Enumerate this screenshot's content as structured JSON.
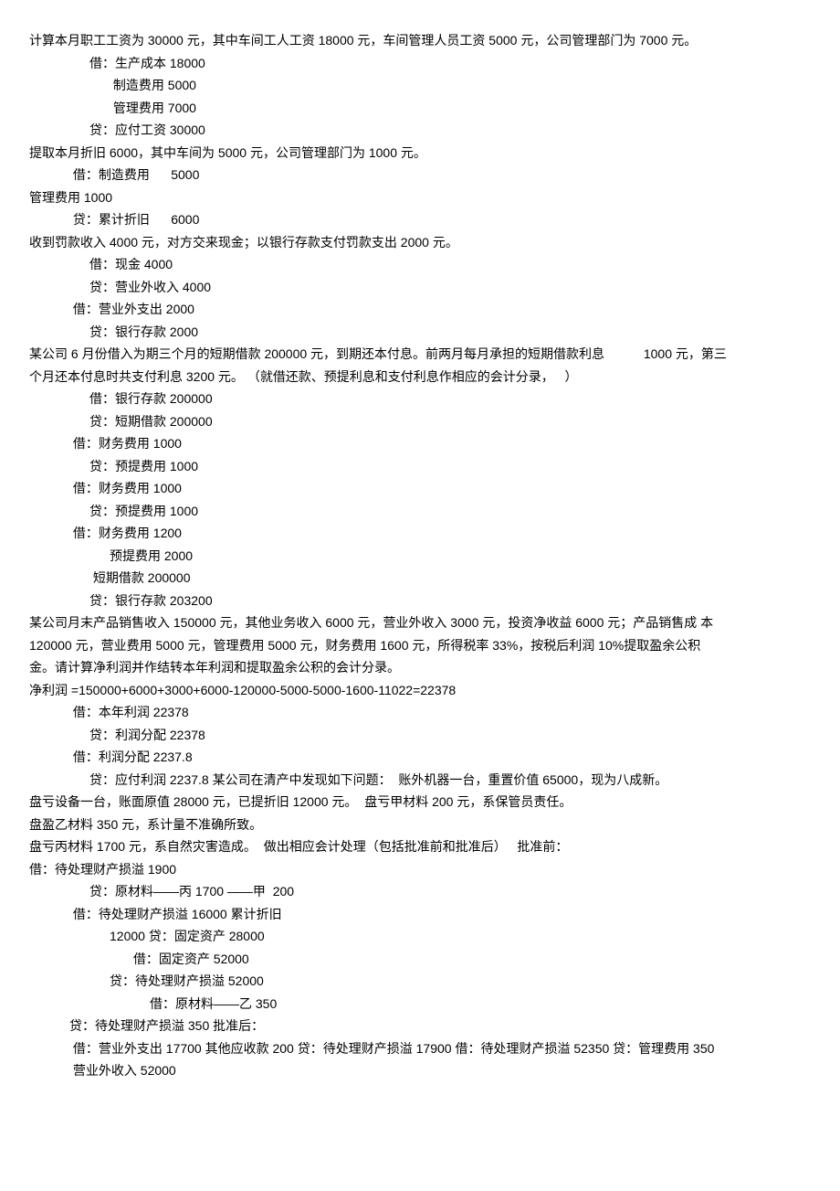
{
  "lines": [
    {
      "indent": 0,
      "text": "计算本月职工工资为 30000 元，其中车间工人工资 18000 元，车间管理人员工资 5000 元，公司管理部门为 7000 元。"
    },
    {
      "indent": 2,
      "text": "借：生产成本 18000"
    },
    {
      "indent": 3,
      "text": " 制造费用 5000"
    },
    {
      "indent": 3,
      "text": " 管理费用 7000"
    },
    {
      "indent": 2,
      "text": "贷：应付工资 30000"
    },
    {
      "indent": 0,
      "text": "提取本月折旧 6000，其中车间为 5000 元，公司管理部门为 1000 元。"
    },
    {
      "indent": 1,
      "text": " 借：制造费用      5000"
    },
    {
      "indent": 0,
      "text": "管理费用 1000"
    },
    {
      "indent": 1,
      "text": " 贷：累计折旧      6000"
    },
    {
      "indent": 0,
      "text": "收到罚款收入 4000 元，对方交来现金；以银行存款支付罚款支出 2000 元。"
    },
    {
      "indent": 2,
      "text": "借：现金 4000"
    },
    {
      "indent": 2,
      "text": "贷：营业外收入 4000"
    },
    {
      "indent": 1,
      "text": " 借：营业外支出 2000"
    },
    {
      "indent": 2,
      "text": "贷：银行存款 2000"
    },
    {
      "indent": 0,
      "text": "某公司 6 月份借入为期三个月的短期借款 200000 元，到期还本付息。前两月每月承担的短期借款利息           1000 元，第三"
    },
    {
      "indent": 0,
      "text": "个月还本付息时共支付利息 3200 元。 （就借还款、预提利息和支付利息作相应的会计分录，   ）"
    },
    {
      "indent": 2,
      "text": "借：银行存款 200000"
    },
    {
      "indent": 2,
      "text": "贷：短期借款 200000"
    },
    {
      "indent": 1,
      "text": " 借：财务费用 1000"
    },
    {
      "indent": 2,
      "text": "贷：预提费用 1000"
    },
    {
      "indent": 1,
      "text": " 借：财务费用 1000"
    },
    {
      "indent": 2,
      "text": "贷：预提费用 1000"
    },
    {
      "indent": 1,
      "text": " 借：财务费用 1200"
    },
    {
      "indent": 3,
      "text": "预提费用 2000"
    },
    {
      "indent": 2,
      "text": " 短期借款 200000"
    },
    {
      "indent": 2,
      "text": "贷：银行存款 203200"
    },
    {
      "indent": 0,
      "text": "某公司月末产品销售收入 150000 元，其他业务收入 6000 元，营业外收入 3000 元，投资净收益 6000 元；产品销售成 本 "
    },
    {
      "indent": 0,
      "text": "120000 元，营业费用 5000 元，管理费用 5000 元，财务费用 1600 元，所得税率 33%，按税后利润 10%提取盈余公积"
    },
    {
      "indent": 0,
      "text": "金。请计算净利润并作结转本年利润和提取盈余公积的会计分录。"
    },
    {
      "indent": 0,
      "text": "净利润 =150000+6000+3000+6000-120000-5000-5000-1600-11022=22378"
    },
    {
      "indent": 1,
      "text": " 借：本年利润 22378"
    },
    {
      "indent": 2,
      "text": "贷：利润分配 22378"
    },
    {
      "indent": 1,
      "text": " 借：利润分配 2237.8"
    },
    {
      "indent": 2,
      "text": "贷：应付利润 2237.8 某公司在清产中发现如下问题：  账外机器一台，重置价值 65000，现为八成新。"
    },
    {
      "indent": 0,
      "text": "盘亏设备一台，账面原值 28000 元，已提折旧 12000 元。  盘亏甲材料 200 元，系保管员责任。"
    },
    {
      "indent": 0,
      "text": "盘盈乙材料 350 元，系计量不准确所致。"
    },
    {
      "indent": 0,
      "text": "盘亏丙材料 1700 元，系自然灾害造成。  做出相应会计处理（包括批准前和批准后）   批准前："
    },
    {
      "indent": 0,
      "text": "借：待处理财产损溢 1900"
    },
    {
      "indent": 2,
      "text": "贷：原材料——丙 1700 ——甲  200"
    },
    {
      "indent": 1,
      "text": " 借：待处理财产损溢 16000 累计折旧"
    },
    {
      "indent": 3,
      "text": "12000 贷：固定资产 28000"
    },
    {
      "indent": 4,
      "text": " 借：固定资产 52000"
    },
    {
      "indent": 3,
      "text": "贷：待处理财产损溢 52000"
    },
    {
      "indent": 5,
      "text": "借：原材料——乙 350"
    },
    {
      "indent": 1,
      "text": "贷：待处理财产损溢 350 批准后："
    },
    {
      "indent": 1,
      "text": " 借：营业外支出 17700 其他应收款 200 贷：待处理财产损溢 17900 借：待处理财产损溢 52350 贷：管理费用 350   "
    },
    {
      "indent": 1,
      "text": " 营业外收入 52000"
    }
  ]
}
